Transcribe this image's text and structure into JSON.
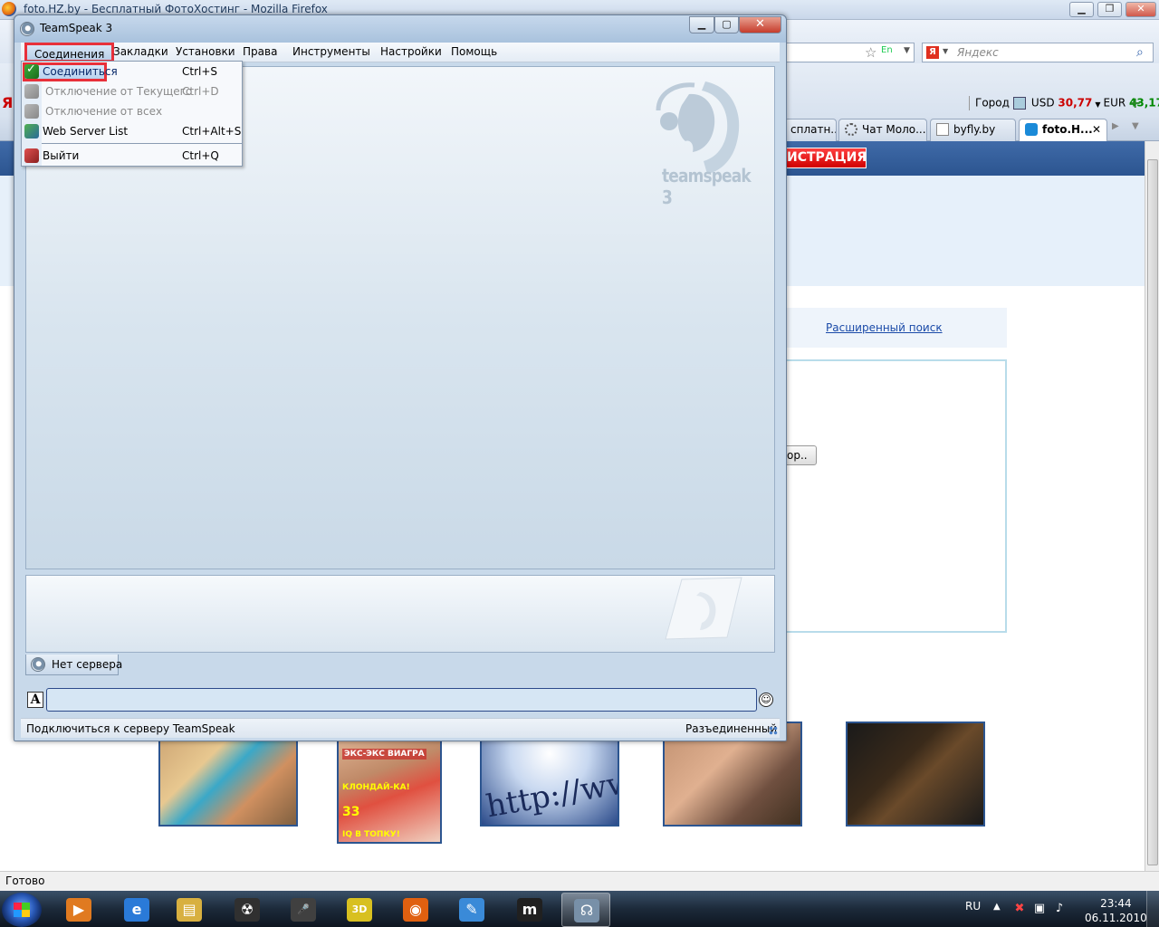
{
  "firefox": {
    "window_title": "foto.HZ.by - Бесплатный ФотоХостинг - Mozilla Firefox",
    "controls": {
      "minimize": "▁",
      "maximize": "❐",
      "close": "✕"
    },
    "search_placeholder": "Яндекс",
    "search_engine_badge": "Я",
    "address_lang_badge": "En",
    "side_brand": "Я",
    "info_bar": {
      "city_label": "Город",
      "usd_label": "USD",
      "usd_value": "30,77",
      "eur_label": "EUR",
      "eur_value": "43,17",
      "add_button": "+"
    },
    "tabs": [
      {
        "label": "сплатн...",
        "icon": "page-icon"
      },
      {
        "label": "Чат Моло...",
        "icon": "loading-icon"
      },
      {
        "label": "byfly.by",
        "icon": "page-icon"
      },
      {
        "label": "foto.H...",
        "icon": "hz-icon",
        "active": true,
        "close": "✕"
      }
    ],
    "page": {
      "register_button": "ИСТРАЦИЯ",
      "advanced_search_link": "Расширенный поиск",
      "browse_button": "ор..",
      "thumb2_lines": [
        "ЭКС-ЭКС ВИАГРА",
        "КЛОНДАЙ-КА!",
        "33",
        "IQ В ТОПКУ!"
      ],
      "thumb3_text": "http://www"
    },
    "status_text": "Готово"
  },
  "teamspeak": {
    "title": "TeamSpeak 3",
    "controls": {
      "minimize": "▁",
      "maximize": "▢",
      "close": "✕"
    },
    "menu": [
      {
        "id": "connections",
        "label": "Соединения",
        "open": true
      },
      {
        "id": "bookmarks",
        "label": "Закладки"
      },
      {
        "id": "installs",
        "label": "Установки"
      },
      {
        "id": "rights",
        "label": "Права"
      },
      {
        "id": "tools",
        "label": "Инструменты"
      },
      {
        "id": "settings",
        "label": "Настройки"
      },
      {
        "id": "help",
        "label": "Помощь"
      }
    ],
    "dropdown": {
      "items": [
        {
          "label": "Соединиться",
          "shortcut": "Ctrl+S",
          "icon": "connect-icon",
          "enabled": true,
          "highlighted": true
        },
        {
          "label": "Отключение от Текущего",
          "shortcut": "Ctrl+D",
          "icon": "disconnect-icon",
          "enabled": false
        },
        {
          "label": "Отключение от всех",
          "shortcut": "",
          "icon": "disconnect-all-icon",
          "enabled": false
        },
        {
          "label": "Web Server List",
          "shortcut": "Ctrl+Alt+S",
          "icon": "web-server-list-icon",
          "enabled": true
        },
        {
          "label": "Выйти",
          "shortcut": "Ctrl+Q",
          "icon": "quit-icon",
          "enabled": true
        }
      ]
    },
    "watermark_text": "teamspeak 3",
    "server_tab_label": "Нет сервера",
    "font_button": "A",
    "chat_input_value": "",
    "emoticon": "☺",
    "status_left": "Подключиться к серверу TeamSpeak",
    "status_right": "Разъединенный"
  },
  "taskbar": {
    "apps": [
      {
        "name": "media-player-icon",
        "glyph": "▶",
        "color": "#e07a20"
      },
      {
        "name": "internet-explorer-icon",
        "glyph": "e",
        "color": "#2a7ad8"
      },
      {
        "name": "file-explorer-icon",
        "glyph": "▤",
        "color": "#d8b040"
      },
      {
        "name": "radiation-icon",
        "glyph": "☢",
        "color": "#303030"
      },
      {
        "name": "microphone-icon",
        "glyph": "🎤",
        "color": "#404040"
      },
      {
        "name": "clapperboard-icon",
        "glyph": "3D",
        "color": "#d8c020"
      },
      {
        "name": "firefox-icon",
        "glyph": "◉",
        "color": "#e06010"
      },
      {
        "name": "paint-icon",
        "glyph": "✎",
        "color": "#3a8ad8"
      },
      {
        "name": "moo-icon",
        "glyph": "m",
        "color": "#202020"
      },
      {
        "name": "teamspeak-icon",
        "glyph": "☊",
        "color": "#7890a8",
        "active": true
      }
    ],
    "tray": {
      "language": "RU",
      "show_hidden": "▲",
      "time": "23:44",
      "date": "06.11.2010"
    }
  },
  "colors": {
    "ts_accent_red": "#e8303a",
    "firefox_banner": "#2c5590",
    "usd_color": "#cc0000",
    "eur_color": "#008800"
  }
}
